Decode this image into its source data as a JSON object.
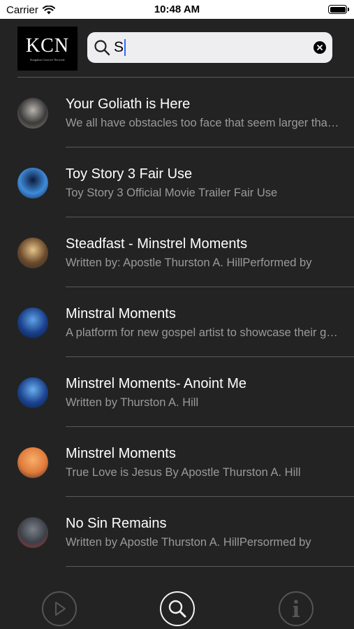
{
  "status_bar": {
    "carrier": "Carrier",
    "time": "10:48 AM"
  },
  "header": {
    "logo_text": "KCN",
    "logo_subtitle": "Kingdom Creative Network",
    "search": {
      "value": "S"
    }
  },
  "results": [
    {
      "title": "Your Goliath is Here",
      "subtitle": "We all have obstacles too face that seem larger than life",
      "thumb_colors": [
        "#b8b4ad",
        "#3a3a3a",
        "#8a847b"
      ]
    },
    {
      "title": "Toy Story 3 Fair Use",
      "subtitle": "Toy Story 3 Official Movie Trailer Fair Use",
      "thumb_colors": [
        "#0b1a3a",
        "#3f8ad8",
        "#0e2a5c"
      ]
    },
    {
      "title": "Steadfast - Minstrel Moments",
      "subtitle": "Written by: Apostle Thurston A. HillPerformed by",
      "thumb_colors": [
        "#e8c48a",
        "#6a4a2c",
        "#2a2a2a"
      ]
    },
    {
      "title": "Minstral Moments",
      "subtitle": "A platform for new gospel artist to showcase their gifts",
      "thumb_colors": [
        "#5fa3e6",
        "#1a3f8a",
        "#0b1a3f"
      ]
    },
    {
      "title": "Minstrel Moments- Anoint Me",
      "subtitle": "Written by Thurston A. Hill",
      "thumb_colors": [
        "#6aaef0",
        "#1c448f",
        "#0a1a40"
      ]
    },
    {
      "title": "Minstrel Moments",
      "subtitle": "True Love is Jesus By Apostle Thurston A. Hill",
      "thumb_colors": [
        "#f7b06b",
        "#e07a3a",
        "#3a2a2a"
      ]
    },
    {
      "title": "No Sin Remains",
      "subtitle": "Written by Apostle Thurston A. HillPersormed by",
      "thumb_colors": [
        "#7b8088",
        "#3c4048",
        "#b03030"
      ]
    }
  ],
  "tab_bar": {
    "tabs": [
      {
        "icon": "play-icon",
        "active": false
      },
      {
        "icon": "search-icon",
        "active": true
      },
      {
        "icon": "info-icon",
        "active": false
      }
    ]
  },
  "colors": {
    "background": "#232323",
    "divider": "#5a5a5a",
    "title_text": "#ffffff",
    "subtitle_text": "#9a9a9a",
    "cursor": "#2f6bff"
  }
}
